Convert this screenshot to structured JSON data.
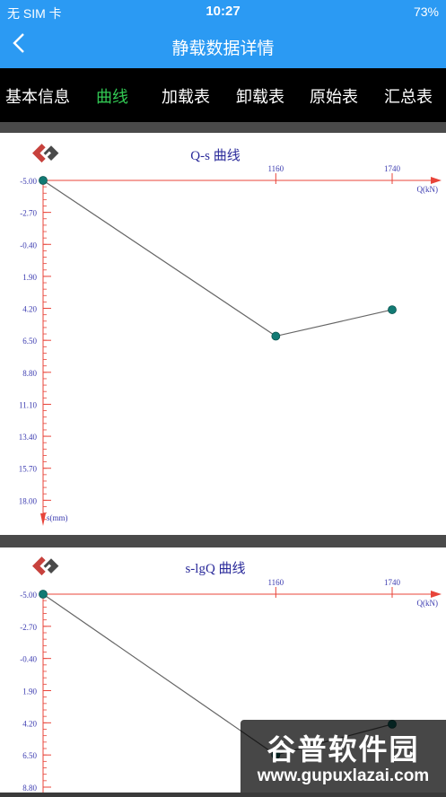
{
  "status_bar": {
    "carrier": "无 SIM 卡",
    "time": "10:27",
    "battery": "73%"
  },
  "nav": {
    "title": "静载数据详情",
    "back_icon": "chevron-left-icon"
  },
  "tabs": [
    "基本信息",
    "曲线",
    "加载表",
    "卸载表",
    "原始表",
    "汇总表"
  ],
  "active_tab": 1,
  "watermark": {
    "line1": "谷普软件园",
    "line2": "www.gupuxlazai.com"
  },
  "chart_data": [
    {
      "type": "line",
      "title": "Q-s 曲线",
      "xlabel": "Q(kN)",
      "ylabel": "s(mm)",
      "x_ticks": [
        "1160",
        "1740"
      ],
      "x_tick_values": [
        1160,
        1740
      ],
      "xlim": [
        0,
        1740
      ],
      "y_ticks": [
        "-5.00",
        "-2.70",
        "-0.40",
        "1.90",
        "4.20",
        "6.50",
        "8.80",
        "11.10",
        "13.40",
        "15.70",
        "18.00"
      ],
      "ylim": [
        -5.0,
        20.3
      ],
      "series": [
        {
          "x": [
            0,
            1160,
            1740
          ],
          "y": [
            -5.0,
            6.2,
            4.3
          ]
        }
      ]
    },
    {
      "type": "line",
      "title": "s-lgQ 曲线",
      "xlabel": "Q(kN)",
      "ylabel": "s(mm)",
      "x_ticks": [
        "1160",
        "1740"
      ],
      "x_tick_values": [
        1160,
        1740
      ],
      "xlim": [
        0,
        1740
      ],
      "y_ticks": [
        "-5.00",
        "-2.70",
        "-0.40",
        "1.90",
        "4.20",
        "6.50",
        "8.80"
      ],
      "ylim": [
        -5.0,
        8.8
      ],
      "series": [
        {
          "x": [
            0,
            1160,
            1740
          ],
          "y": [
            -5.0,
            6.5,
            4.3
          ]
        }
      ]
    }
  ]
}
